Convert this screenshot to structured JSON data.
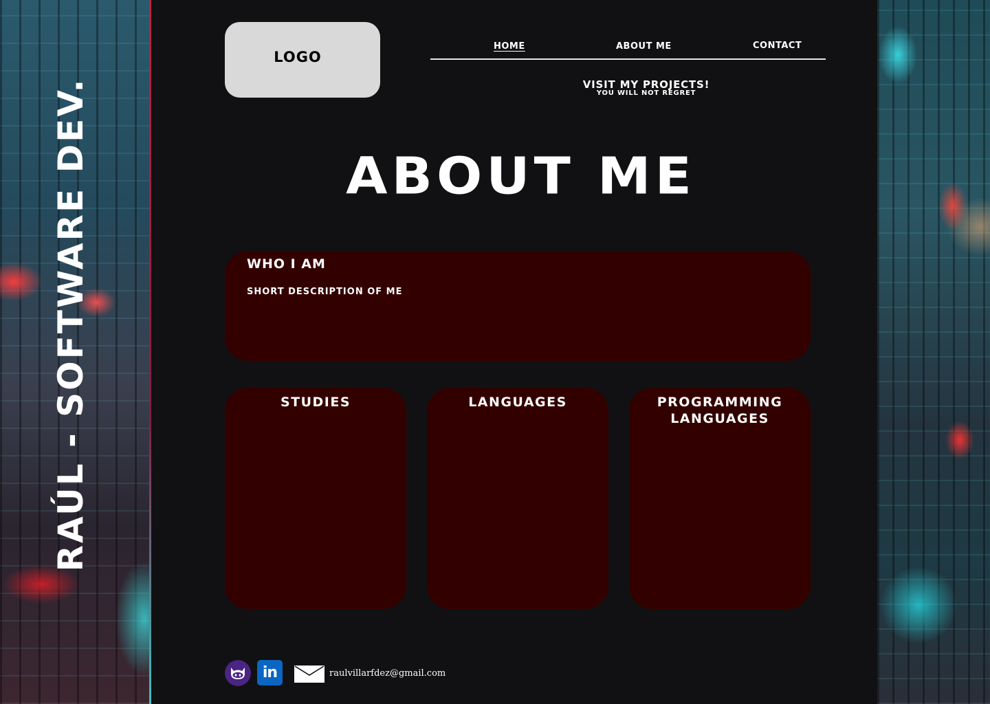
{
  "side_banner": {
    "text": "Raúl - Software Dev."
  },
  "header": {
    "logo_label": "LOGO",
    "nav": [
      {
        "label": "HOME",
        "active": true
      },
      {
        "label": "ABOUT ME",
        "active": false
      },
      {
        "label": "CONTACT",
        "active": false
      }
    ],
    "promo_title": "VISIT MY PROJECTS!",
    "promo_subtitle": "YOU WILL NOT REGRET"
  },
  "main": {
    "page_title": "ABOUT ME",
    "who": {
      "title": "WHO I AM",
      "description": "SHORT DESCRIPTION OF ME"
    },
    "cards": [
      {
        "title": "STUDIES"
      },
      {
        "title": "LANGUAGES"
      },
      {
        "title": "PROGRAMMING LANGUAGES"
      }
    ]
  },
  "footer": {
    "github_icon": "github-icon",
    "linkedin_icon": "linkedin-icon",
    "linkedin_glyph": "in",
    "mail_icon": "mail-icon",
    "email": "raulvillarfdez@gmail.com"
  },
  "colors": {
    "background": "#111113",
    "card": "#330000",
    "logo_box": "#d9d9d9",
    "github": "#4b2484",
    "linkedin": "#0a66c2"
  }
}
